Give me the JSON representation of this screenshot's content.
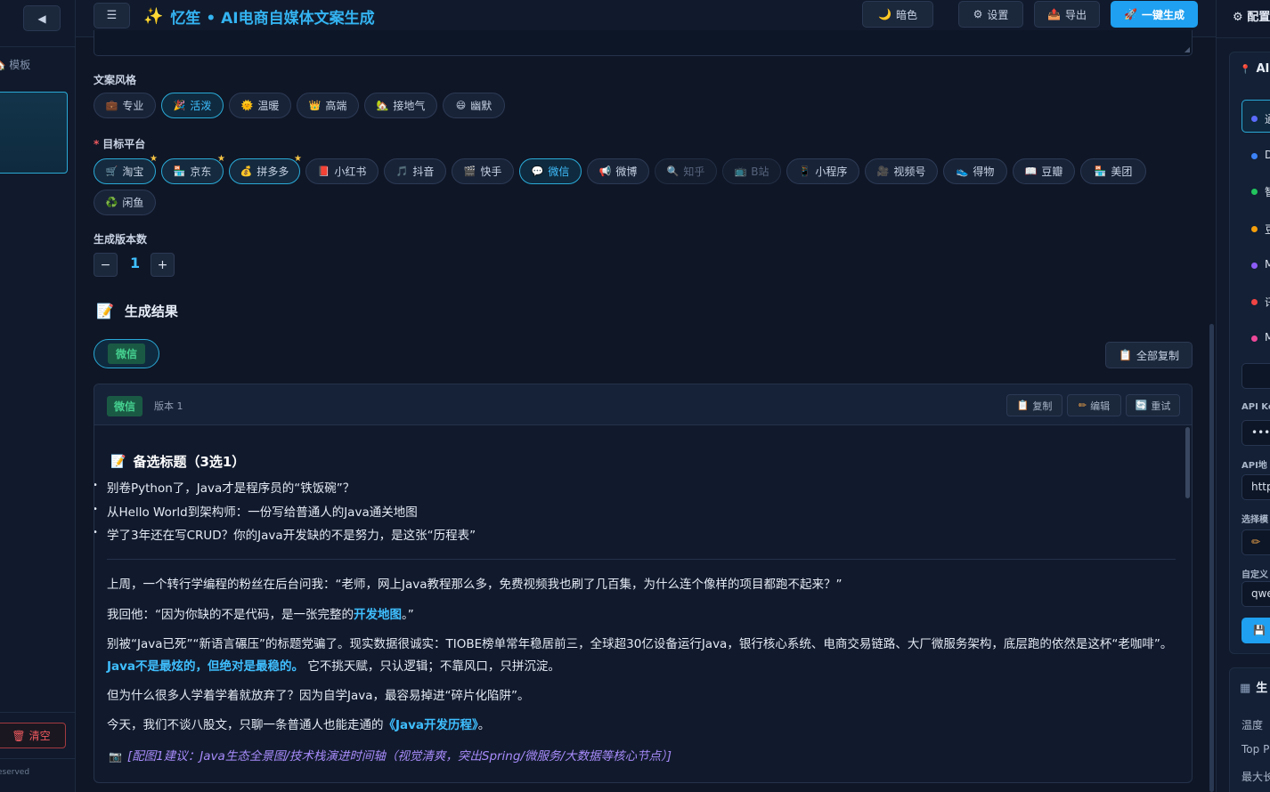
{
  "app": {
    "title": "忆笙 • AI电商自媒体文案生成",
    "title_icon": "sparkles-icon"
  },
  "header": {
    "theme_label": "暗色",
    "settings_label": "设置",
    "export_label": "导出",
    "generate_label": "一键生成"
  },
  "left_sidebar": {
    "collapse_symbol": "◀",
    "templates_label": "模板",
    "clear_label": "清空",
    "footer_text": "eserved"
  },
  "right_panel": {
    "title": "配置",
    "ai_section_title": "AI",
    "options": [
      {
        "letter": "通",
        "color": "#5b6cff"
      },
      {
        "letter": "D",
        "color": "#3b82f6"
      },
      {
        "letter": "智",
        "color": "#22c55e"
      },
      {
        "letter": "豆",
        "color": "#f59e0b"
      },
      {
        "letter": "M",
        "color": "#8b5cf6"
      },
      {
        "letter": "讯",
        "color": "#ef4444"
      },
      {
        "letter": "M",
        "color": "#ec4899"
      }
    ],
    "api_key_label": "API Ke",
    "api_key_value": "••••",
    "api_url_label": "API地",
    "api_url_value": "http",
    "model_label": "选择模",
    "custom_label": "自定义",
    "custom_value": "qwe",
    "gen_section_title": "生",
    "temperature_label": "温度",
    "top_p_label": "Top P",
    "max_len_label": "最大长"
  },
  "form": {
    "style_label": "文案风格",
    "styles": [
      {
        "label": "专业",
        "icon": "💼",
        "active": false
      },
      {
        "label": "活泼",
        "icon": "🎉",
        "active": true
      },
      {
        "label": "温暖",
        "icon": "🌞",
        "active": false
      },
      {
        "label": "高端",
        "icon": "👑",
        "active": false
      },
      {
        "label": "接地气",
        "icon": "🏡",
        "active": false
      },
      {
        "label": "幽默",
        "icon": "😄",
        "active": false
      }
    ],
    "platform_required_mark": "*",
    "platform_label": "目标平台",
    "platforms": [
      {
        "label": "淘宝",
        "icon": "🛒",
        "state": "starred"
      },
      {
        "label": "京东",
        "icon": "🏪",
        "state": "starred"
      },
      {
        "label": "拼多多",
        "icon": "💰",
        "state": "starred"
      },
      {
        "label": "小红书",
        "icon": "📕",
        "state": "normal"
      },
      {
        "label": "抖音",
        "icon": "🎵",
        "state": "normal"
      },
      {
        "label": "快手",
        "icon": "🎬",
        "state": "normal"
      },
      {
        "label": "微信",
        "icon": "💬",
        "state": "active"
      },
      {
        "label": "微博",
        "icon": "📢",
        "state": "normal"
      },
      {
        "label": "知乎",
        "icon": "🔍",
        "state": "disabled"
      },
      {
        "label": "B站",
        "icon": "📺",
        "state": "disabled"
      },
      {
        "label": "小程序",
        "icon": "📱",
        "state": "normal"
      },
      {
        "label": "视频号",
        "icon": "🎥",
        "state": "normal"
      },
      {
        "label": "得物",
        "icon": "👟",
        "state": "normal"
      },
      {
        "label": "豆瓣",
        "icon": "📖",
        "state": "normal"
      },
      {
        "label": "美团",
        "icon": "🏪",
        "state": "normal"
      },
      {
        "label": "闲鱼",
        "icon": "♻️",
        "state": "normal"
      }
    ],
    "count_label": "生成版本数",
    "count_value": "1",
    "minus": "−",
    "plus": "+"
  },
  "results": {
    "title": "生成结果",
    "active_tab": "微信",
    "copy_all_label": "全部复制",
    "card": {
      "platform": "微信",
      "version": "版本 1",
      "copy_label": "复制",
      "edit_label": "编辑",
      "retry_label": "重试",
      "alt_title_heading": "备选标题（3选1）",
      "alt_titles": [
        "别卷Python了，Java才是程序员的“铁饭碗”？",
        "从Hello World到架构师：一份写给普通人的Java通关地图",
        "学了3年还在写CRUD？你的Java开发缺的不是努力，是这张“历程表”"
      ],
      "p1": "上周，一个转行学编程的粉丝在后台问我：“老师，网上Java教程那么多，免费视频我也刷了几百集，为什么连个像样的项目都跑不起来？”",
      "p2_a": "我回他：“因为你缺的不是代码，是一张完整的",
      "p2_hl": "开发地图",
      "p2_b": "。”",
      "p3_a": "别被“Java已死”“新语言碾压”的标题党骗了。现实数据很诚实：TIOBE榜单常年稳居前三，全球超30亿设备运行Java，银行核心系统、电商交易链路、大厂微服务架构，底层跑的依然是这杯“老咖啡”。",
      "p3_hl": "Java不是最炫的，但绝对是最稳的。",
      "p3_b": " 它不挑天赋，只认逻辑；不靠风口，只拼沉淀。",
      "p4": "但为什么很多人学着学着就放弃了？因为自学Java，最容易掉进“碎片化陷阱”。",
      "p5_a": "今天，我们不谈八股文，只聊一条普通人也能走通的",
      "p5_hl": "《Java开发历程》",
      "p5_b": "。",
      "image_suggestion": "[配图1建议：Java生态全景图/技术栈演进时间轴（视觉清爽，突出Spring/微服务/大数据等核心节点）]"
    }
  }
}
